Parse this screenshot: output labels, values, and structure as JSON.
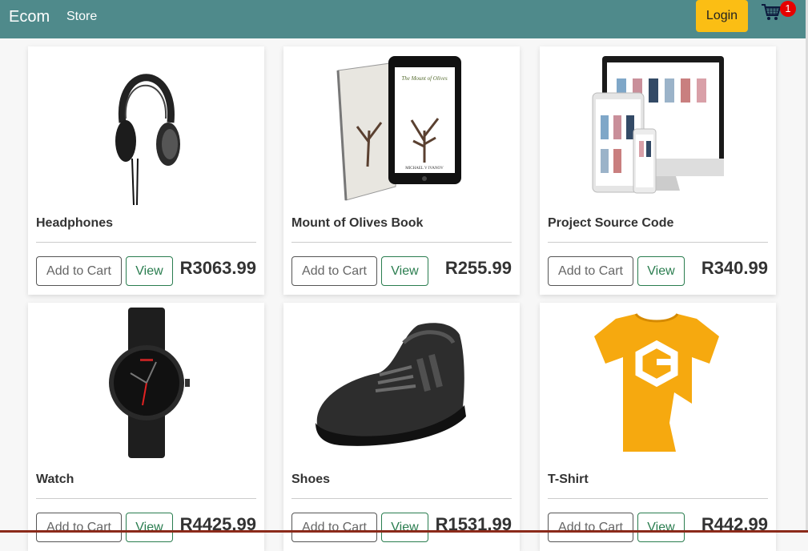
{
  "navbar": {
    "brand": "Ecom",
    "store_link": "Store",
    "login_label": "Login",
    "cart_count": "1"
  },
  "products": [
    {
      "title": "Headphones",
      "add_label": "Add to Cart",
      "view_label": "View",
      "price": "R3063.99"
    },
    {
      "title": "Mount of Olives Book",
      "add_label": "Add to Cart",
      "view_label": "View",
      "price": "R255.99",
      "book_cover_title": "The Mount of Olives",
      "book_author": "MICHAEL V IVANOV"
    },
    {
      "title": "Project Source Code",
      "add_label": "Add to Cart",
      "view_label": "View",
      "price": "R340.99"
    },
    {
      "title": "Watch",
      "add_label": "Add to Cart",
      "view_label": "View",
      "price": "R4425.99"
    },
    {
      "title": "Shoes",
      "add_label": "Add to Cart",
      "view_label": "View",
      "price": "R1531.99"
    },
    {
      "title": "T-Shirt",
      "add_label": "Add to Cart",
      "view_label": "View",
      "price": "R442.99"
    }
  ],
  "colors": {
    "navbar": "#4f8a8b",
    "login": "#fbbe14",
    "badge": "#e60000",
    "view": "#2a7d4f"
  }
}
